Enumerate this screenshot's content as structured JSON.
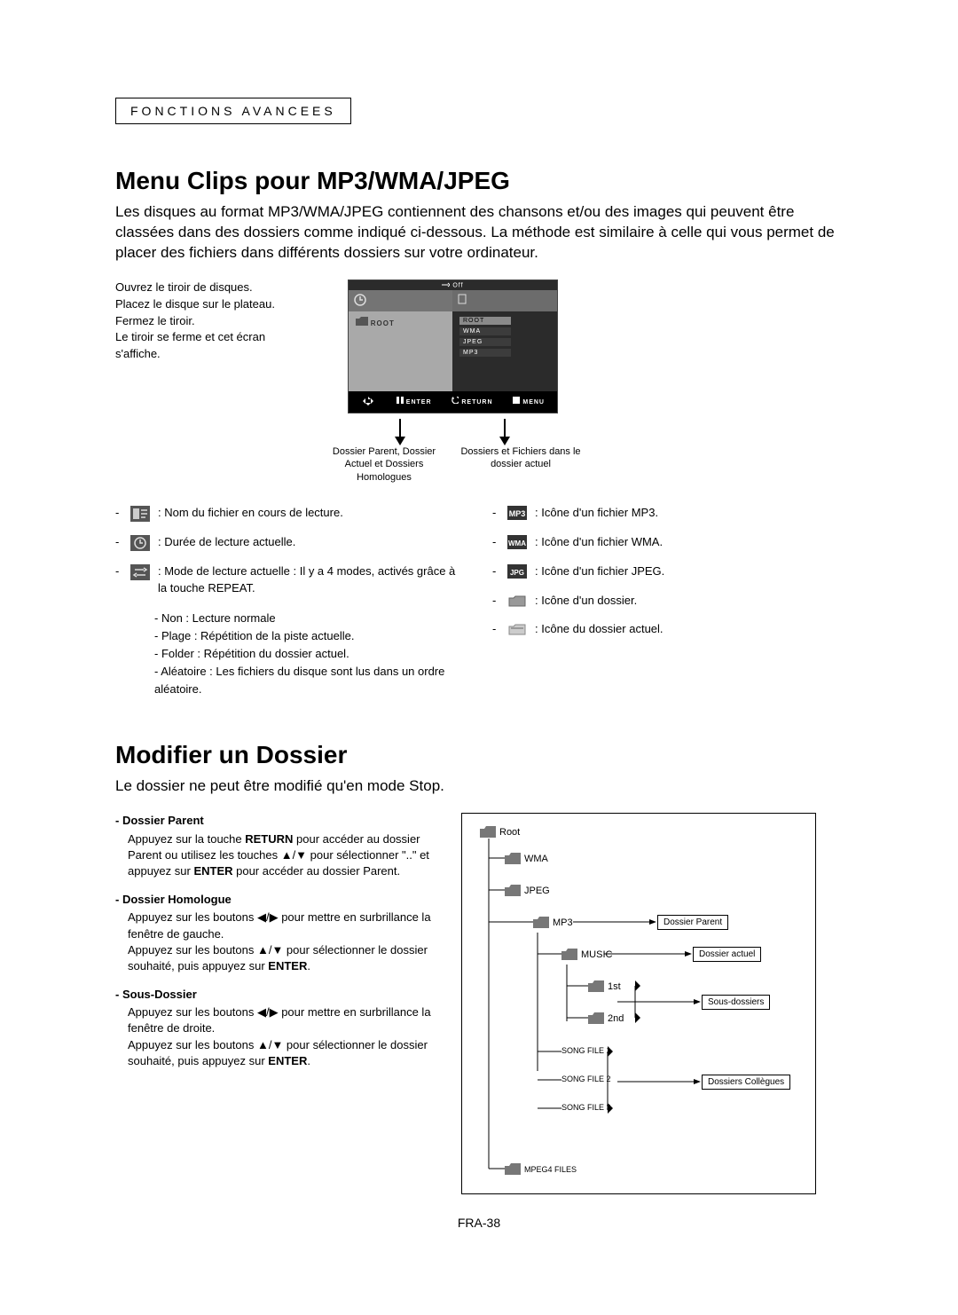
{
  "section_tag": "Fonctions Avancees",
  "heading1": "Menu Clips pour MP3/WMA/JPEG",
  "intro": "Les disques au format MP3/WMA/JPEG contiennent des chansons et/ou des images qui peuvent être classées dans des dossiers comme indiqué ci-dessous. La méthode est similaire à celle qui vous permet de placer des fichiers dans différents dossiers sur votre ordinateur.",
  "panel_text": "Ouvrez le tiroir de disques.\nPlacez le disque sur le plateau.\nFermez le tiroir.\nLe tiroir se ferme et cet écran s'affiche.",
  "screenshot": {
    "off": "Off",
    "left_root": "ROOT",
    "right": {
      "root": "ROOT",
      "wma": "WMA",
      "jpeg": "JPEG",
      "mp3": "MP3"
    },
    "footer": {
      "enter": "ENTER",
      "return": "RETURN",
      "menu": "MENU"
    }
  },
  "caption_left": "Dossier Parent, Dossier Actuel et Dossiers Homologues",
  "caption_right": "Dossiers et Fichiers dans le dossier actuel",
  "legend_left": [
    {
      "icon": "file-playing-icon",
      "text": ": Nom du fichier en cours de lecture."
    },
    {
      "icon": "clock-icon",
      "text": ": Durée de lecture actuelle."
    },
    {
      "icon": "repeat-icon",
      "text": ": Mode de lecture actuelle : Il y a 4 modes, activés grâce à la touche REPEAT."
    }
  ],
  "legend_modes": [
    "Non : Lecture normale",
    "Plage : Répétition de la piste actuelle.",
    "Folder : Répétition du dossier actuel.",
    "Aléatoire : Les fichiers du disque sont lus dans un ordre aléatoire."
  ],
  "legend_right": [
    {
      "icon": "mp3-icon",
      "text": ": Icône d'un fichier MP3."
    },
    {
      "icon": "wma-icon",
      "text": ": Icône d'un fichier WMA."
    },
    {
      "icon": "jpeg-icon",
      "text": ": Icône d'un fichier JPEG."
    },
    {
      "icon": "folder-icon",
      "text": ": Icône d'un dossier."
    },
    {
      "icon": "current-folder-icon",
      "text": ": Icône du dossier actuel."
    }
  ],
  "heading2": "Modifier un Dossier",
  "modify_intro": "Le dossier ne peut être modifié qu'en mode Stop.",
  "modify_blocks": [
    {
      "title": "Dossier Parent",
      "body_parts": [
        "Appuyez sur la touche ",
        "RETURN",
        " pour accéder au dossier Parent ou utilisez les touches ▲/▼ pour sélectionner \"..\" et appuyez sur ",
        "ENTER",
        " pour accéder au dossier Parent."
      ]
    },
    {
      "title": "Dossier Homologue",
      "body_parts": [
        "Appuyez sur les boutons ◀/▶ pour mettre en surbrillance la fenêtre de gauche.\nAppuyez sur les boutons ▲/▼ pour sélectionner le dossier souhaité, puis appuyez sur ",
        "ENTER",
        "."
      ]
    },
    {
      "title": "Sous-Dossier",
      "body_parts": [
        "Appuyez sur les boutons ◀/▶ pour mettre en surbrillance la fenêtre de droite.\nAppuyez sur les boutons ▲/▼ pour sélectionner le dossier souhaité, puis appuyez sur ",
        "ENTER",
        "."
      ]
    }
  ],
  "tree": {
    "root": "Root",
    "wma": "WMA",
    "jpeg": "JPEG",
    "mp3": "MP3",
    "music": "MUSIC",
    "first": "1st",
    "second": "2nd",
    "song1": "SONG FILE 1",
    "song2": "SONG FILE 2",
    "song3": "SONG FILE 3",
    "mpeg4": "MPEG4 FILES",
    "lbl_parent": "Dossier Parent",
    "lbl_current": "Dossier actuel",
    "lbl_sub": "Sous-dossiers",
    "lbl_peers": "Dossiers Collègues"
  },
  "page_number": "FRA-38"
}
